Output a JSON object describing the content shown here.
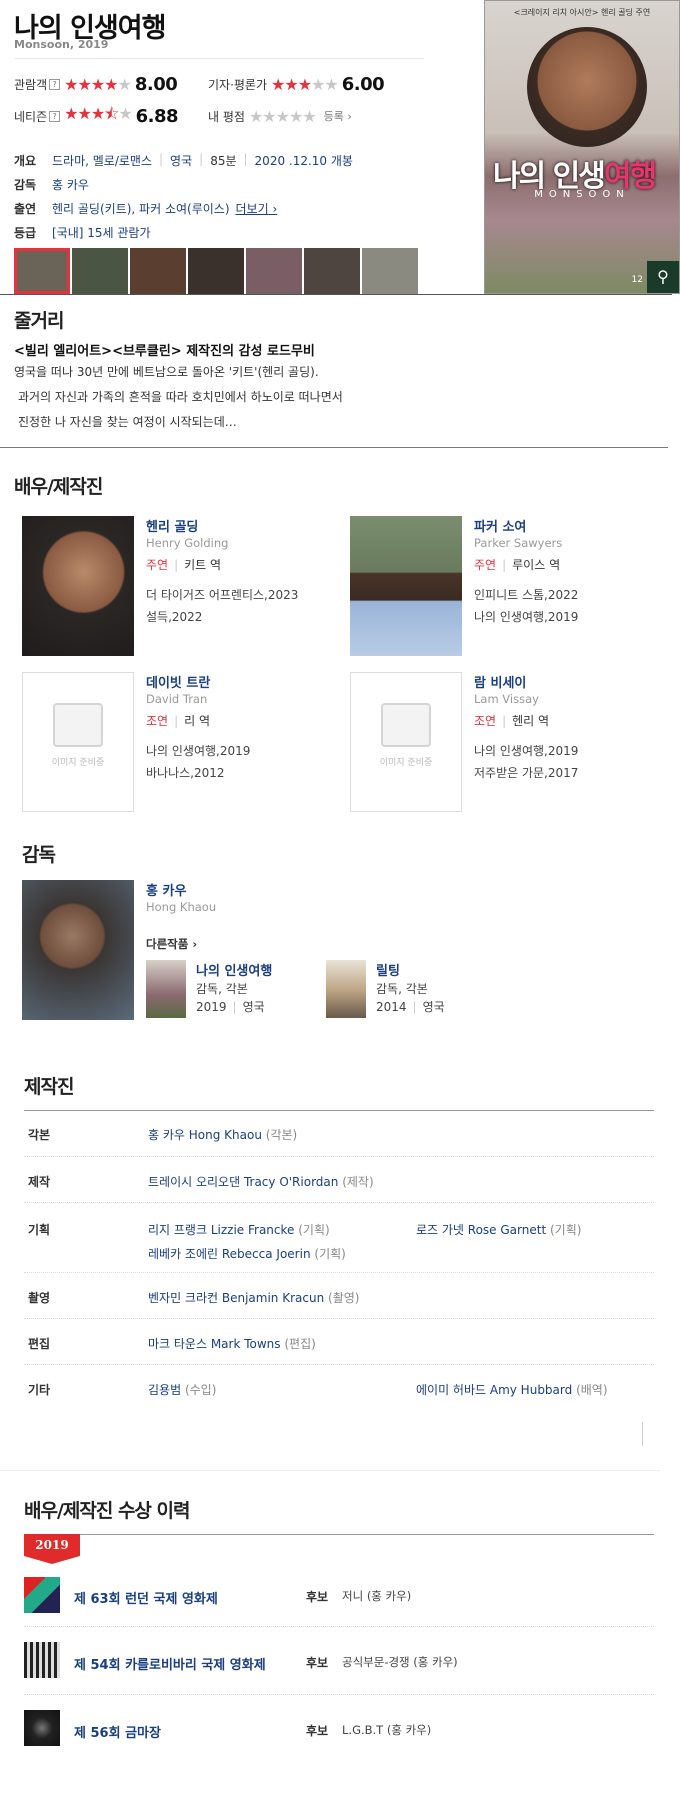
{
  "movie": {
    "title": "나의 인생여행",
    "subtitle": "Monsoon, 2019"
  },
  "ratings": {
    "audience": {
      "label": "관람객",
      "help": "?",
      "score": "8.00",
      "stars_on": 4
    },
    "critics": {
      "label": "기자·평론가",
      "score": "6.00",
      "stars_on": 3
    },
    "netizen": {
      "label": "네티즌",
      "help": "?",
      "score": "6.88",
      "stars_on": 3.5
    },
    "mine": {
      "label": "내 평점",
      "register": "등록"
    }
  },
  "info": {
    "overview_key": "개요",
    "genre": "드라마, 멜로/로맨스",
    "country": "영국",
    "runtime": "85분",
    "release": "2020 .12.10 개봉",
    "director_key": "감독",
    "director": "홍 카우",
    "cast_key": "출연",
    "cast": "헨리 골딩(키트), 파커 소여(루이스)",
    "more": "더보기",
    "grade_key": "등급",
    "grade": "[국내] 15세 관람가"
  },
  "poster": {
    "top_text": "<크레이지 리치 아시안> 헨리 골딩 주연",
    "title_a": "나",
    "title_b": "의 인생",
    "title_c": "여행",
    "en": "MONSOON",
    "count": "12"
  },
  "synopsis": {
    "heading": "줄거리",
    "headline": "<빌리 엘리어트><브루클린> 제작진의 감성 로드무비",
    "line1": "영국을 떠나 30년 만에 베트남으로 돌아온 '키트'(헨리 골딩).",
    "line2": "과거의 자신과 가족의 흔적을 따라 호치민에서 하노이로 떠나면서",
    "line3": "진정한 나 자신을 찾는 여정이 시작되는데…"
  },
  "cast_section": {
    "heading": "배우/제작진",
    "no_image": "이미지 준비중",
    "people": [
      {
        "name": "헨리 골딩",
        "en": "Henry Golding",
        "role": "주연",
        "char": "키트 역",
        "w1": "더 타이거즈 어프렌티스,2023",
        "w2": "설득,2022"
      },
      {
        "name": "파커 소여",
        "en": "Parker Sawyers",
        "role": "주연",
        "char": "루이스 역",
        "w1": "인피니트 스톰,2022",
        "w2": "나의 인생여행,2019"
      },
      {
        "name": "데이빗 트란",
        "en": "David Tran",
        "role": "조연",
        "char": "리 역",
        "w1": "나의 인생여행,2019",
        "w2": "바나나스,2012"
      },
      {
        "name": "람 비세이",
        "en": "Lam Vissay",
        "role": "조연",
        "char": "헨리 역",
        "w1": "나의 인생여행,2019",
        "w2": "저주받은 가문,2017"
      }
    ]
  },
  "director_section": {
    "heading": "감독",
    "name": "홍 카우",
    "en": "Hong Khaou",
    "other_works": "다른작품",
    "works": [
      {
        "title": "나의 인생여행",
        "role": "감독, 각본",
        "year": "2019",
        "country": "영국"
      },
      {
        "title": "릴팅",
        "role": "감독, 각본",
        "year": "2014",
        "country": "영국"
      }
    ]
  },
  "crew_section": {
    "heading": "제작진",
    "rows": [
      {
        "key": "각본",
        "p1": "홍 카우 Hong Khaou",
        "d1": "(각본)"
      },
      {
        "key": "제작",
        "p1": "트레이시 오리오댄 Tracy O'Riordan",
        "d1": "(제작)"
      },
      {
        "key": "기획",
        "p1": "리지 프랭크 Lizzie Francke",
        "d1": "(기획)",
        "p2": "로즈 가넷 Rose Garnett",
        "d2": "(기획)",
        "p3": "레베카 조에린 Rebecca Joerin",
        "d3": "(기획)"
      },
      {
        "key": "촬영",
        "p1": "벤자민 크라컨 Benjamin Kracun",
        "d1": "(촬영)"
      },
      {
        "key": "편집",
        "p1": "마크 타운스 Mark Towns",
        "d1": "(편집)"
      },
      {
        "key": "기타",
        "p1": "김용범",
        "d1": "(수입)",
        "p2": "에이미 허바드 Amy Hubbard",
        "d2": "(배역)"
      }
    ]
  },
  "awards_section": {
    "heading": "배우/제작진 수상 이력",
    "year": "2019",
    "items": [
      {
        "name": "제 63회 런던 국제 영화제",
        "status": "후보",
        "desc": "저니 (홍 카우)"
      },
      {
        "name": "제 54회 카를로비바리 국제 영화제",
        "status": "후보",
        "desc": "공식부문-경쟁 (홍 카우)"
      },
      {
        "name": "제 56회 금마장",
        "status": "후보",
        "desc": "L.G.B.T (홍 카우)"
      }
    ]
  }
}
